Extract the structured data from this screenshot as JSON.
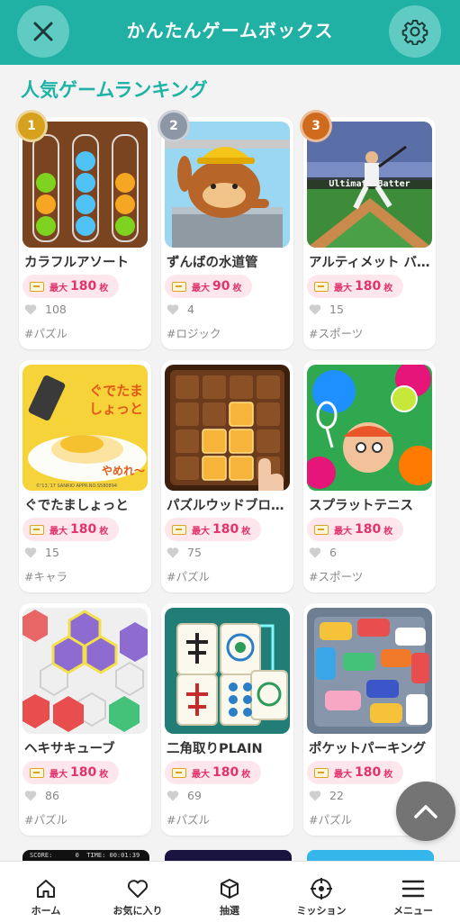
{
  "header": {
    "title": "かんたんゲームボックス",
    "close_icon": "close-icon",
    "settings_icon": "gear-icon",
    "bg_color": "#21b0a4"
  },
  "section": {
    "title": "人気ゲームランキング"
  },
  "reward_prefix": "最大",
  "reward_unit": "枚",
  "games": [
    {
      "rank": "1",
      "name": "カラフルアソート",
      "reward": "180",
      "likes": "108",
      "tag": "#パズル"
    },
    {
      "rank": "2",
      "name": "ずんばの水道管",
      "reward": "90",
      "likes": "4",
      "tag": "#ロジック"
    },
    {
      "rank": "3",
      "name": "アルティメット バ…",
      "reward": "180",
      "likes": "15",
      "tag": "#スポーツ"
    },
    {
      "rank": "",
      "name": "ぐでたましょっと",
      "reward": "180",
      "likes": "15",
      "tag": "#キャラ"
    },
    {
      "rank": "",
      "name": "パズルウッドブロ…",
      "reward": "180",
      "likes": "75",
      "tag": "#パズル"
    },
    {
      "rank": "",
      "name": "スプラットテニス",
      "reward": "180",
      "likes": "6",
      "tag": "#スポーツ"
    },
    {
      "rank": "",
      "name": "ヘキサキューブ",
      "reward": "180",
      "likes": "86",
      "tag": "#パズル"
    },
    {
      "rank": "",
      "name": "二角取りPLAIN",
      "reward": "180",
      "likes": "69",
      "tag": "#パズル"
    },
    {
      "rank": "",
      "name": "ポケットパーキング",
      "reward": "180",
      "likes": "22",
      "tag": "#パズル"
    }
  ],
  "thumb_text": {
    "batter_logo": "Ultimate Batter",
    "gudetama_line1": "ぐでたま",
    "gudetama_line2": "しょっと",
    "gudetama_sub": "やめれ〜",
    "gudetama_copyright": "©'13,'17 SANRIO APPR.NO.S580894",
    "peek_score": "SCORE:      0  TIME: 00:01:39"
  },
  "scroll_top": {
    "icon": "chevron-up-icon"
  },
  "nav": [
    {
      "label": "ホーム",
      "icon": "home-icon"
    },
    {
      "label": "お気に入り",
      "icon": "heart-icon"
    },
    {
      "label": "抽選",
      "icon": "box-icon"
    },
    {
      "label": "ミッション",
      "icon": "target-icon"
    },
    {
      "label": "メニュー",
      "icon": "menu-icon"
    }
  ]
}
